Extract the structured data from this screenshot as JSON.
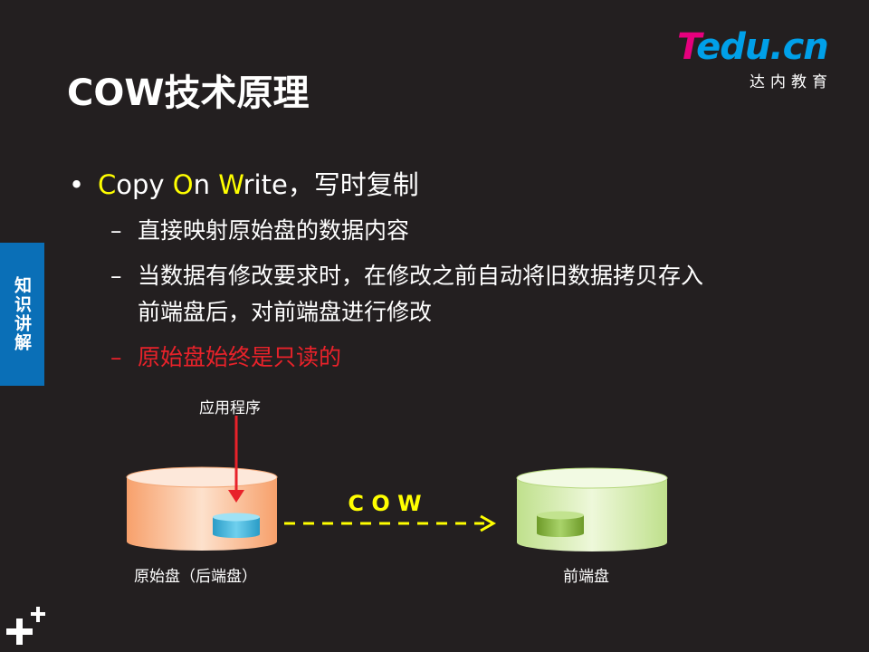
{
  "logo": {
    "brand_t": "T",
    "brand_rest": "edu.cn",
    "subtitle": "达内教育"
  },
  "title": "COW技术原理",
  "side_tab": "知识讲解",
  "bullet": {
    "symbol": "•",
    "c1": "C",
    "t1": "opy ",
    "c2": "O",
    "t2": "n ",
    "c3": "W",
    "t3": "rite，写时复制"
  },
  "subs": {
    "dash": "–",
    "s1": "直接映射原始盘的数据内容",
    "s2a": "当数据有修改要求时，在修改之前自动将旧数据拷贝存入",
    "s2b": "前端盘后，对前端盘进行修改",
    "s3": "原始盘始终是只读的"
  },
  "diagram": {
    "app_label": "应用程序",
    "cow_label": "C O W",
    "left_disk_label": "原始盘（后端盘）",
    "right_disk_label": "前端盘"
  },
  "colors": {
    "background": "#231f20",
    "accent_yellow": "#ffff00",
    "accent_red": "#e8222a",
    "tab_blue": "#0a6fb7",
    "logo_pink": "#e6007e",
    "logo_blue": "#00a0e9"
  },
  "icons": [
    "plus-decoration-icon"
  ]
}
